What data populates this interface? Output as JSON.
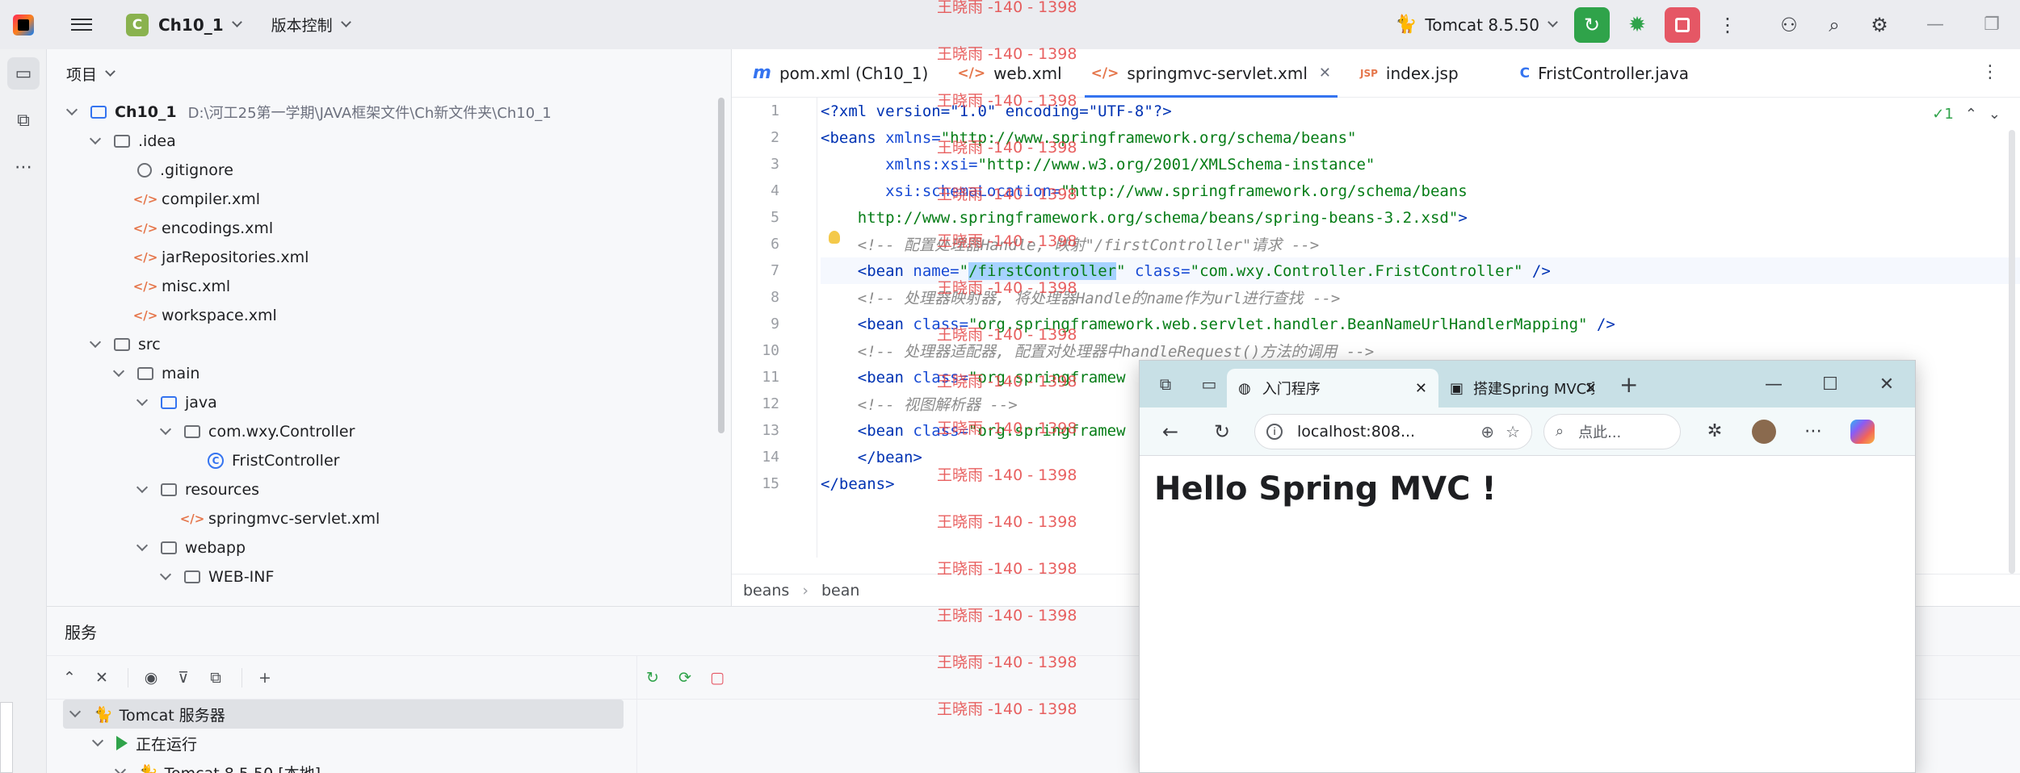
{
  "titlebar": {
    "project_badge": "C",
    "project_name": "Ch10_1",
    "vcs_label": "版本控制",
    "run_config": "Tomcat 8.5.50"
  },
  "project_panel": {
    "title": "项目",
    "tree": [
      {
        "label": "Ch10_1",
        "hint": "D:\\河工25第一学期\\JAVA框架文件\\Ch新文件夹\\Ch10_1",
        "indent": 0,
        "icon": "module-folder-icon",
        "expanded": true
      },
      {
        "label": ".idea",
        "indent": 1,
        "icon": "folder-icon",
        "expanded": true
      },
      {
        "label": ".gitignore",
        "indent": 2,
        "icon": "ignore-file-icon"
      },
      {
        "label": "compiler.xml",
        "indent": 2,
        "icon": "xml-file-icon"
      },
      {
        "label": "encodings.xml",
        "indent": 2,
        "icon": "xml-file-icon"
      },
      {
        "label": "jarRepositories.xml",
        "indent": 2,
        "icon": "xml-file-icon"
      },
      {
        "label": "misc.xml",
        "indent": 2,
        "icon": "xml-file-icon"
      },
      {
        "label": "workspace.xml",
        "indent": 2,
        "icon": "xml-file-icon"
      },
      {
        "label": "src",
        "indent": 1,
        "icon": "folder-icon",
        "expanded": true
      },
      {
        "label": "main",
        "indent": 2,
        "icon": "folder-icon",
        "expanded": true
      },
      {
        "label": "java",
        "indent": 3,
        "icon": "source-folder-icon",
        "expanded": true
      },
      {
        "label": "com.wxy.Controller",
        "indent": 4,
        "icon": "package-icon",
        "expanded": true
      },
      {
        "label": "FristController",
        "indent": 5,
        "icon": "class-icon"
      },
      {
        "label": "resources",
        "indent": 3,
        "icon": "resources-folder-icon",
        "expanded": true
      },
      {
        "label": "springmvc-servlet.xml",
        "indent": 4,
        "icon": "xml-file-icon"
      },
      {
        "label": "webapp",
        "indent": 3,
        "icon": "web-folder-icon",
        "expanded": true
      },
      {
        "label": "WEB-INF",
        "indent": 4,
        "icon": "folder-icon",
        "expanded": true
      }
    ]
  },
  "editor": {
    "tabs": [
      {
        "label": "pom.xml (Ch10_1)",
        "icon": "m",
        "active": false
      },
      {
        "label": "web.xml",
        "icon": "</>",
        "active": false
      },
      {
        "label": "springmvc-servlet.xml",
        "icon": "</>",
        "active": true
      },
      {
        "label": "index.jsp",
        "icon": "JSP",
        "active": false
      },
      {
        "label": "FristController.java",
        "icon": "C",
        "active": false
      }
    ],
    "inspection_count": "1",
    "line_numbers": [
      "1",
      "2",
      "3",
      "4",
      "5",
      "6",
      "7",
      "8",
      "9",
      "10",
      "11",
      "12",
      "13",
      "14",
      "15"
    ],
    "lines": {
      "l1": "<?xml version=\"1.0\" encoding=\"UTF-8\"?>",
      "l2_tag": "<beans ",
      "l2_attr": "xmlns=",
      "l2_val": "\"http://www.springframework.org/schema/beans\"",
      "l3_attr": "xmlns:xsi=",
      "l3_val": "\"http://www.w3.org/2001/XMLSchema-instance\"",
      "l4_attr": "xsi:schemaLocation=",
      "l4_val": "\"http://www.springframework.org/schema/beans",
      "l5_val": "http://www.springframework.org/schema/beans/spring-beans-3.2.xsd\"",
      "l5_end": ">",
      "l6": "<!-- 配置处理器Handle, 映射\"/firstController\"请求 -->",
      "l7_tag": "<bean ",
      "l7_attr1": "name=",
      "l7_q1": "\"",
      "l7_sel": "/firstController",
      "l7_q2": "\"",
      "l7_attr2": " class=",
      "l7_val2": "\"com.wxy.Controller.FristController\"",
      "l7_end": " />",
      "l8": "<!-- 处理器映射器, 将处理器Handle的name作为url进行查找 -->",
      "l9_tag": "<bean ",
      "l9_attr": "class=",
      "l9_val": "\"org.springframework.web.servlet.handler.BeanNameUrlHandlerMapping\"",
      "l9_end": " />",
      "l10": "<!-- 处理器适配器, 配置对处理器中handleRequest()方法的调用 -->",
      "l11_tag": "<bean ",
      "l11_attr": "class=",
      "l11_val": "\"org.springframew",
      "l12": "<!-- 视图解析器 -->",
      "l13_tag": "<bean ",
      "l13_attr": "class=",
      "l13_val": "\"org.springframew",
      "l14": "</bean>",
      "l15": "</beans>"
    },
    "breadcrumbs": [
      "beans",
      "bean"
    ]
  },
  "services": {
    "title": "服务",
    "tree": [
      {
        "label": "Tomcat 服务器",
        "indent": 0,
        "selected": true
      },
      {
        "label": "正在运行",
        "indent": 1
      },
      {
        "label": "Tomcat 8.5.50 [本地]",
        "indent": 2
      }
    ]
  },
  "browser": {
    "tabs": [
      {
        "label": "入门程序",
        "active": true
      },
      {
        "label": "搭建Spring MVC项目",
        "active": false
      }
    ],
    "url": "localhost:808...",
    "search_placeholder": "点此...",
    "heading": "Hello Spring MVC !"
  },
  "watermark": "王晓雨 -140 - 1398"
}
